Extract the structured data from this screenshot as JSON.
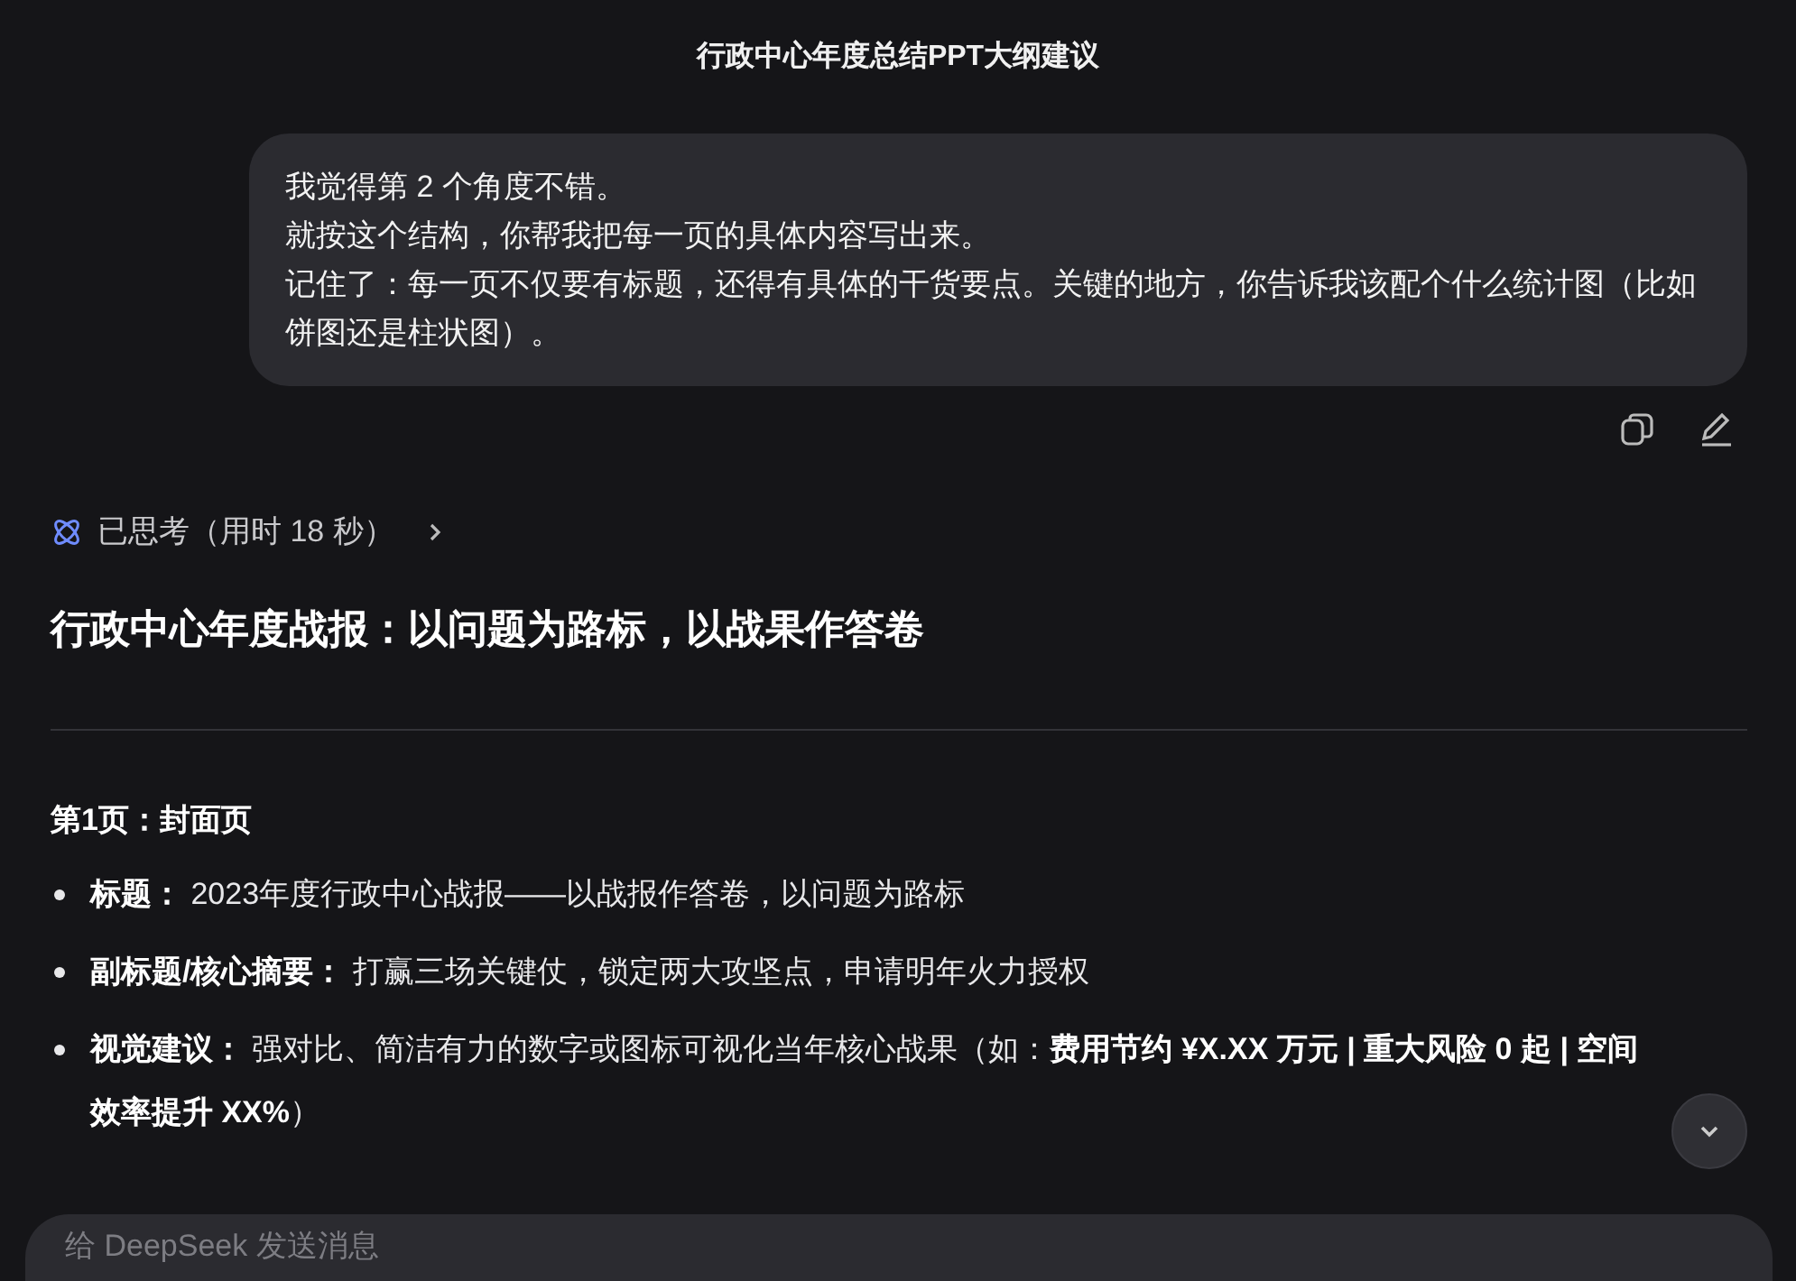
{
  "window": {
    "title": "行政中心年度总结PPT大纲建议"
  },
  "user_message": {
    "lines": [
      "我觉得第 2 个角度不错。",
      "就按这个结构，你帮我把每一页的具体内容写出来。",
      "记住了：每一页不仅要有标题，还得有具体的干货要点。关键的地方，你告诉我该配个什么统计图（比如饼图还是柱状图）。"
    ]
  },
  "thinking": {
    "label": "已思考（用时 18 秒）",
    "expanded": false
  },
  "answer": {
    "heading": "行政中心年度战报：以问题为路标，以战果作答卷",
    "section_title": "第1页：封面页",
    "bullets": [
      {
        "text": "**标题：** 2023年度行政中心战报——以战报作答卷，以问题为路标"
      },
      {
        "text": "**副标题/核心摘要：** 打赢三场关键仗，锁定两大攻坚点，申请明年火力授权"
      },
      {
        "text": "**视觉建议：** 强对比、简洁有力的数字或图标可视化当年核心战果（如：**费用节约 ¥X.XX 万元 | 重大风险 0 起 | 空间效率提升 XX%**）"
      }
    ]
  },
  "composer": {
    "placeholder": "给 DeepSeek 发送消息"
  }
}
